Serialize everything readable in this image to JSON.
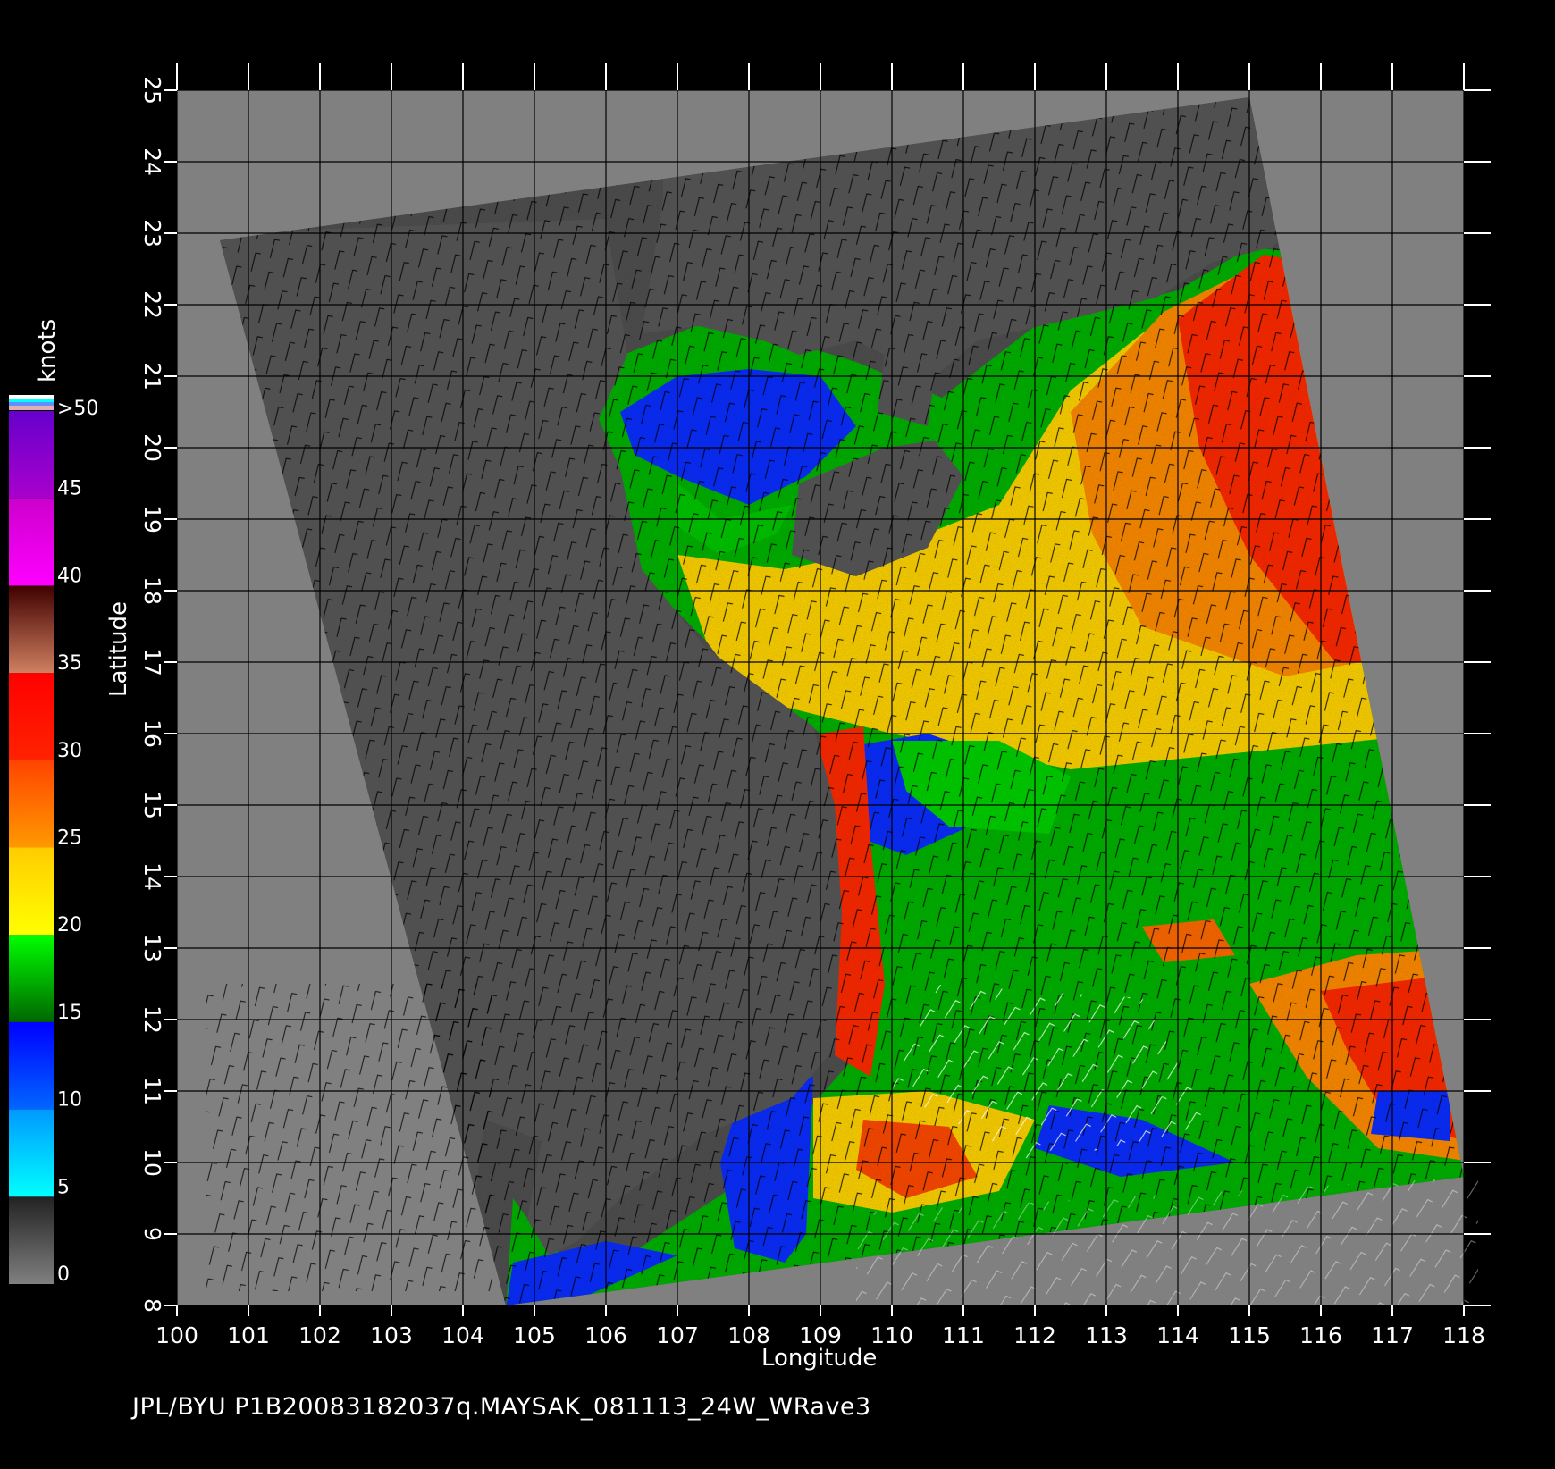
{
  "title": "JPL/BYU  P1B20083182037q.MAYSAK_081113_24W_WRave3",
  "map": {
    "xlabel": "Longitude",
    "ylabel": "Latitude",
    "lon_range": [
      100,
      118
    ],
    "lat_range": [
      8,
      25
    ],
    "lon_ticks": [
      "100",
      "101",
      "102",
      "103",
      "104",
      "105",
      "106",
      "107",
      "108",
      "109",
      "110",
      "111",
      "112",
      "113",
      "114",
      "115",
      "116",
      "117",
      "118"
    ],
    "lat_ticks": [
      "8",
      "9",
      "10",
      "11",
      "12",
      "13",
      "14",
      "15",
      "16",
      "17",
      "18",
      "19",
      "20",
      "21",
      "22",
      "23",
      "24",
      "25"
    ],
    "swath_corners_lonlat": [
      [
        100.6,
        22.9
      ],
      [
        115.0,
        24.9
      ],
      [
        118.0,
        9.8
      ],
      [
        104.6,
        8.0
      ]
    ],
    "colors": {
      "background": "#000000",
      "outside_swath": "#808080",
      "land": "#505050",
      "rain_flag": "#ffffff"
    }
  },
  "colorbar": {
    "unit": "knots",
    "tick_labels": [
      ">50",
      "45",
      "40",
      "35",
      "30",
      "25",
      "20",
      "15",
      "10",
      "5",
      "0"
    ],
    "bands": [
      {
        "from": 0,
        "to": 5,
        "colors": [
          "#808080",
          "#222222"
        ]
      },
      {
        "from": 5,
        "to": 10,
        "colors": [
          "#00ffff",
          "#0099ff"
        ]
      },
      {
        "from": 10,
        "to": 15,
        "colors": [
          "#0066ff",
          "#0000ff"
        ]
      },
      {
        "from": 15,
        "to": 20,
        "colors": [
          "#006600",
          "#00ff00"
        ]
      },
      {
        "from": 20,
        "to": 25,
        "colors": [
          "#ffff00",
          "#ffcc00"
        ]
      },
      {
        "from": 25,
        "to": 30,
        "colors": [
          "#ff9900",
          "#ff4400"
        ]
      },
      {
        "from": 30,
        "to": 35,
        "colors": [
          "#ff2200",
          "#ff0000"
        ]
      },
      {
        "from": 35,
        "to": 40,
        "colors": [
          "#d08060",
          "#400000"
        ]
      },
      {
        "from": 40,
        "to": 45,
        "colors": [
          "#ff00ff",
          "#cc00cc"
        ]
      },
      {
        "from": 45,
        "to": 50,
        "colors": [
          "#aa00cc",
          "#6600cc"
        ]
      }
    ]
  }
}
